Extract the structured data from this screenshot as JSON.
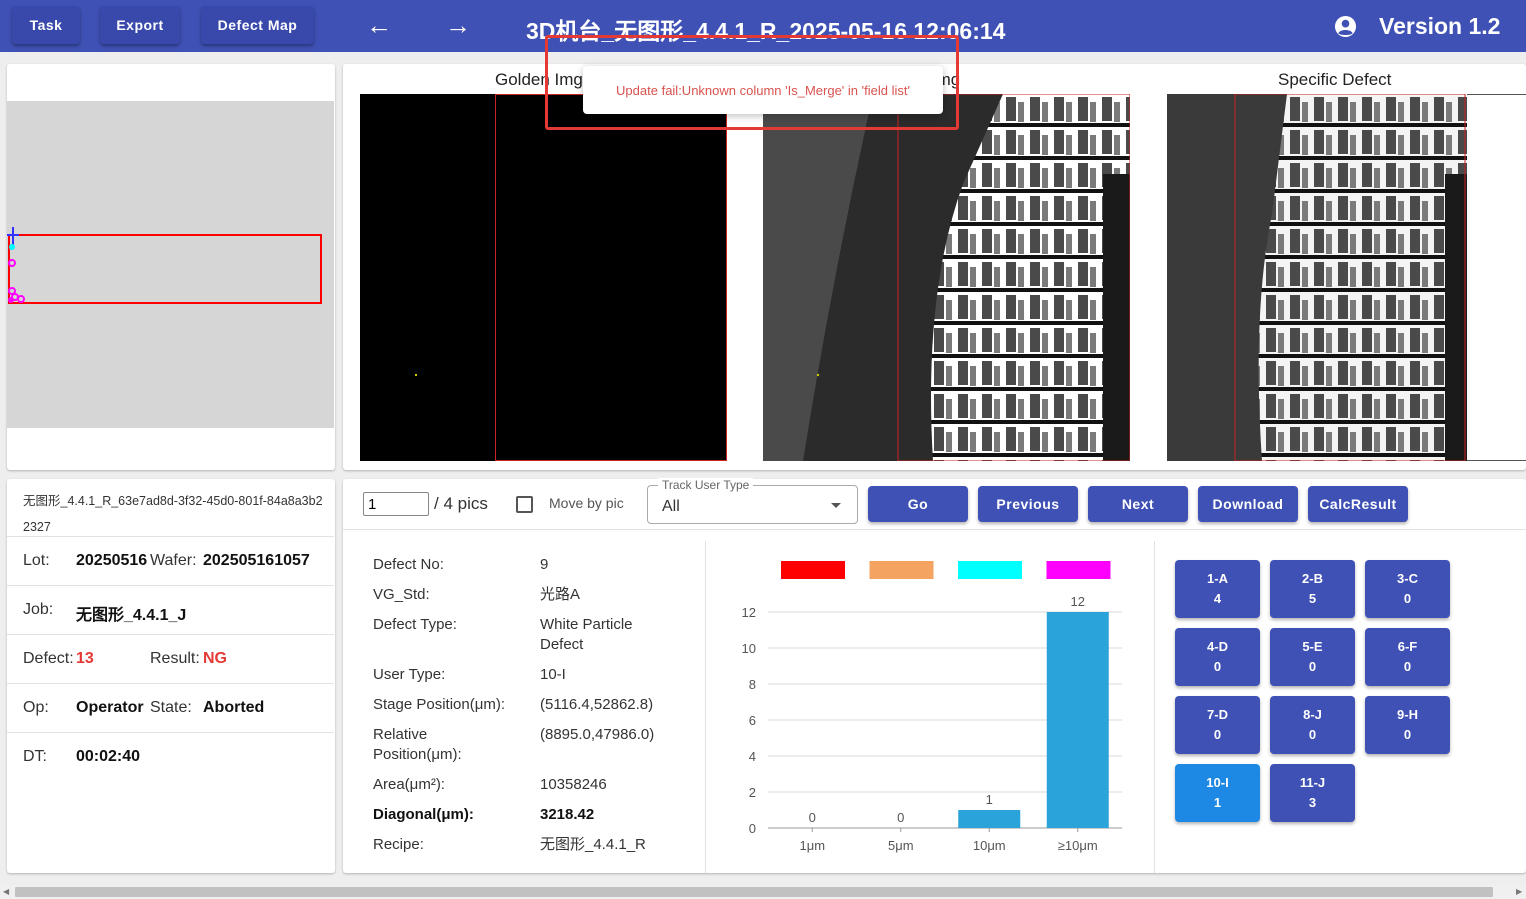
{
  "header": {
    "buttons": [
      "Task",
      "Export",
      "Defect Map"
    ],
    "title": "3D机台_无图形_4.4.1_R_2025-05-16 12:06:14",
    "version": "Version 1.2"
  },
  "toast": {
    "message": "Update fail:Unknown column 'Is_Merge' in 'field list'"
  },
  "images": {
    "golden_title": "Golden Img",
    "test_title": "Test Img",
    "specific_title": "Specific Defect"
  },
  "info": {
    "file_name": "无图形_4.4.1_R_63e7ad8d-3f32-45d0-801f-84a8a3b22327",
    "lot_label": "Lot:",
    "lot_value": "20250516",
    "wafer_label": "Wafer:",
    "wafer_value": "202505161057",
    "job_label": "Job:",
    "job_value": "无图形_4.4.1_J",
    "defect_label": "Defect:",
    "defect_value": "13",
    "result_label": "Result:",
    "result_value": "NG",
    "op_label": "Op:",
    "op_value": "Operator",
    "state_label": "State:",
    "state_value": "Aborted",
    "dt_label": "DT:",
    "dt_value": "00:02:40"
  },
  "controls": {
    "page_input": "1",
    "pics_text": "/ 4 pics",
    "move_by_pic": "Move by pic",
    "track_label": "Track User Type",
    "track_value": "All",
    "buttons": [
      "Go",
      "Previous",
      "Next",
      "Download",
      "CalcResult"
    ]
  },
  "details": [
    {
      "label": "Defect No:",
      "value": "9"
    },
    {
      "label": "VG_Std:",
      "value": "光路A"
    },
    {
      "label": "Defect Type:",
      "value": "White Particle Defect"
    },
    {
      "label": "User Type:",
      "value": "10-I"
    },
    {
      "label": "Stage Position(μm):",
      "value": "(5116.4,52862.8)"
    },
    {
      "label": "Relative Position(μm):",
      "value": "(8895.0,47986.0)"
    },
    {
      "label": "Area(μm²):",
      "value": "10358246"
    },
    {
      "label": "Diagonal(μm):",
      "value": "3218.42"
    },
    {
      "label": "Recipe:",
      "value": "无图形_4.4.1_R"
    }
  ],
  "chart_data": {
    "type": "bar",
    "categories": [
      "1μm",
      "5μm",
      "10μm",
      "≥10μm"
    ],
    "values": [
      0,
      0,
      1,
      12
    ],
    "ylim": [
      0,
      12
    ],
    "yticks": [
      0,
      2,
      4,
      6,
      8,
      10,
      12
    ],
    "legend_colors": [
      "#ff0000",
      "#f4a460",
      "#00ffff",
      "#ff00ff"
    ],
    "bar_color": "#29a3d9",
    "grid": true
  },
  "cells": [
    {
      "label": "1-A",
      "count": "4"
    },
    {
      "label": "2-B",
      "count": "5"
    },
    {
      "label": "3-C",
      "count": "0"
    },
    {
      "label": "4-D",
      "count": "0"
    },
    {
      "label": "5-E",
      "count": "0"
    },
    {
      "label": "6-F",
      "count": "0"
    },
    {
      "label": "7-D",
      "count": "0"
    },
    {
      "label": "8-J",
      "count": "0"
    },
    {
      "label": "9-H",
      "count": "0"
    },
    {
      "label": "10-I",
      "count": "1"
    },
    {
      "label": "11-J",
      "count": "3"
    }
  ]
}
